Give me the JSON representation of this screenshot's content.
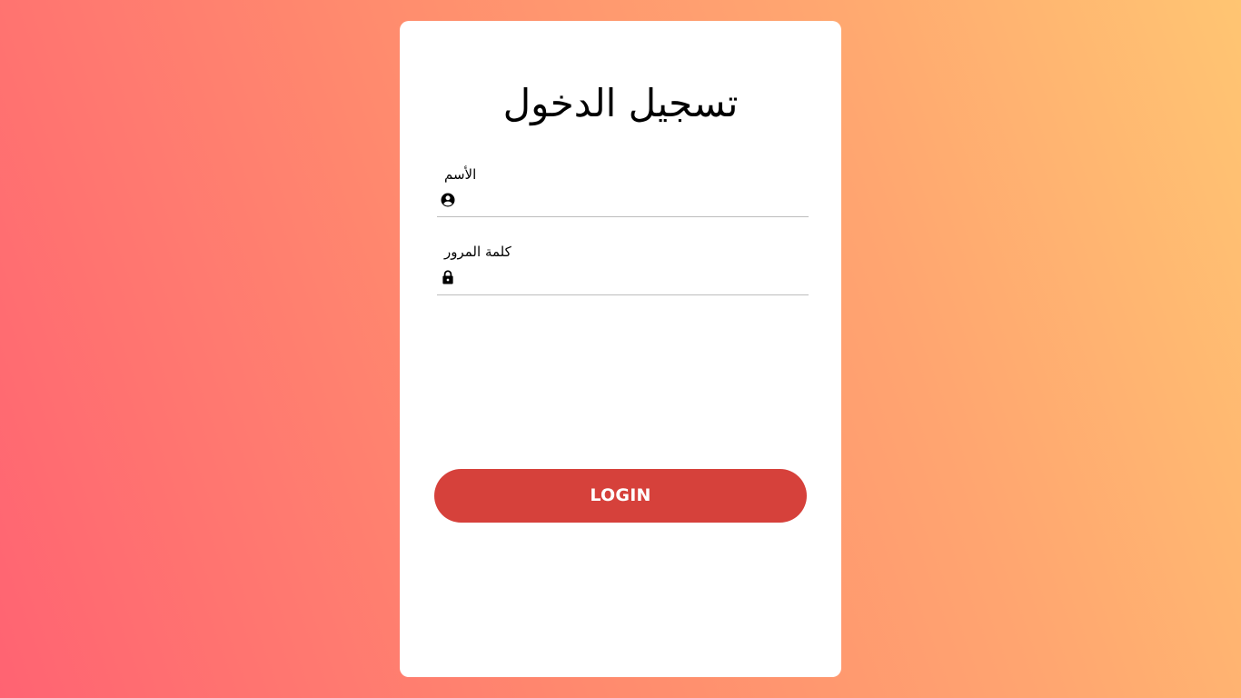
{
  "login_form": {
    "title": "تسجيل الدخول",
    "username": {
      "label": "الأسم",
      "value": "",
      "icon": "account-circle-icon"
    },
    "password": {
      "label": "كلمة المرور",
      "value": "",
      "icon": "lock-icon"
    },
    "submit_label": "LOGIN"
  },
  "colors": {
    "gradient_start": "#ff6372",
    "gradient_end": "#ffc572",
    "card": "#ffffff",
    "button": "#d6413b",
    "button_text": "#ffffff"
  }
}
